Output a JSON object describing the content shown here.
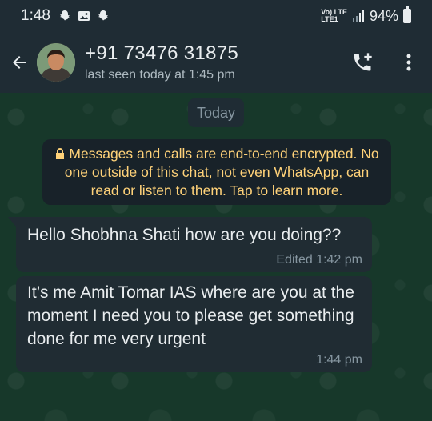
{
  "status_bar": {
    "time": "1:48",
    "network_top": "Vo) LTE",
    "network_bottom": "LTE1",
    "battery": "94%"
  },
  "header": {
    "contact_name": "+91 73476 31875",
    "last_seen": "last seen today at 1:45 pm"
  },
  "chat": {
    "date_chip": "Today",
    "encryption_notice": "Messages and calls are end-to-end encrypted. No one outside of this chat, not even WhatsApp, can read or listen to them. Tap to learn more.",
    "messages": [
      {
        "text": "Hello Shobhna Shati how are you doing??",
        "meta": "Edited 1:42 pm"
      },
      {
        "text": "It’s me Amit Tomar IAS where are you at the moment I need you to please get something done for me very urgent",
        "meta": "1:44 pm"
      }
    ]
  },
  "colors": {
    "header_bg": "#1f2c34",
    "chat_bg": "#17382a",
    "bubble_bg": "#202c33",
    "notice_text": "#ffd279",
    "meta_text": "#8696a0"
  },
  "icons": [
    "snapchat-ghost-icon",
    "gallery-icon",
    "back-arrow-icon",
    "add-call-icon",
    "more-vertical-icon",
    "lock-icon",
    "signal-icon",
    "battery-icon"
  ]
}
